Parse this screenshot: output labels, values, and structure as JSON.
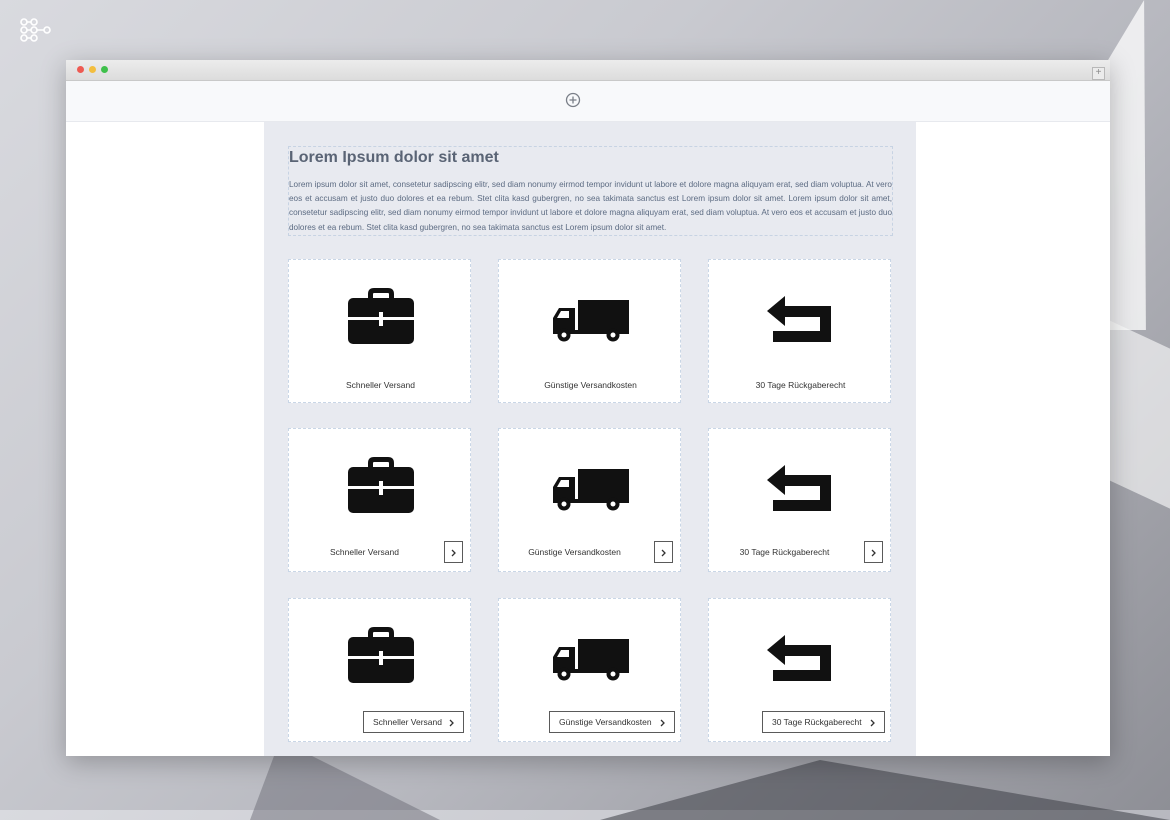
{
  "content": {
    "heading": "Lorem Ipsum dolor sit amet",
    "paragraph": "Lorem ipsum dolor sit amet, consetetur sadipscing elitr, sed diam nonumy eirmod tempor invidunt ut labore et dolore magna aliquyam erat, sed diam voluptua. At vero eos et accusam et justo duo dolores et ea rebum. Stet clita kasd gubergren, no sea takimata sanctus est Lorem ipsum dolor sit amet. Lorem ipsum dolor sit amet, consetetur sadipscing elitr, sed diam nonumy eirmod tempor invidunt ut labore et dolore magna aliquyam erat, sed diam voluptua. At vero eos et accusam et justo duo dolores et ea rebum. Stet clita kasd gubergren, no sea takimata sanctus est Lorem ipsum dolor sit amet."
  },
  "features": [
    {
      "label": "Schneller Versand",
      "icon": "briefcase-icon"
    },
    {
      "label": "Günstige Versandkosten",
      "icon": "truck-icon"
    },
    {
      "label": "30 Tage Rückgaberecht",
      "icon": "return-arrow-icon"
    }
  ],
  "rows": [
    {
      "variant": "label-only"
    },
    {
      "variant": "label-with-arrow-button"
    },
    {
      "variant": "label-in-button"
    }
  ],
  "colors": {
    "canvas": "#e8eaf0",
    "heading": "#5a6475",
    "paragraph": "#5c6b82",
    "icon": "#111111"
  }
}
